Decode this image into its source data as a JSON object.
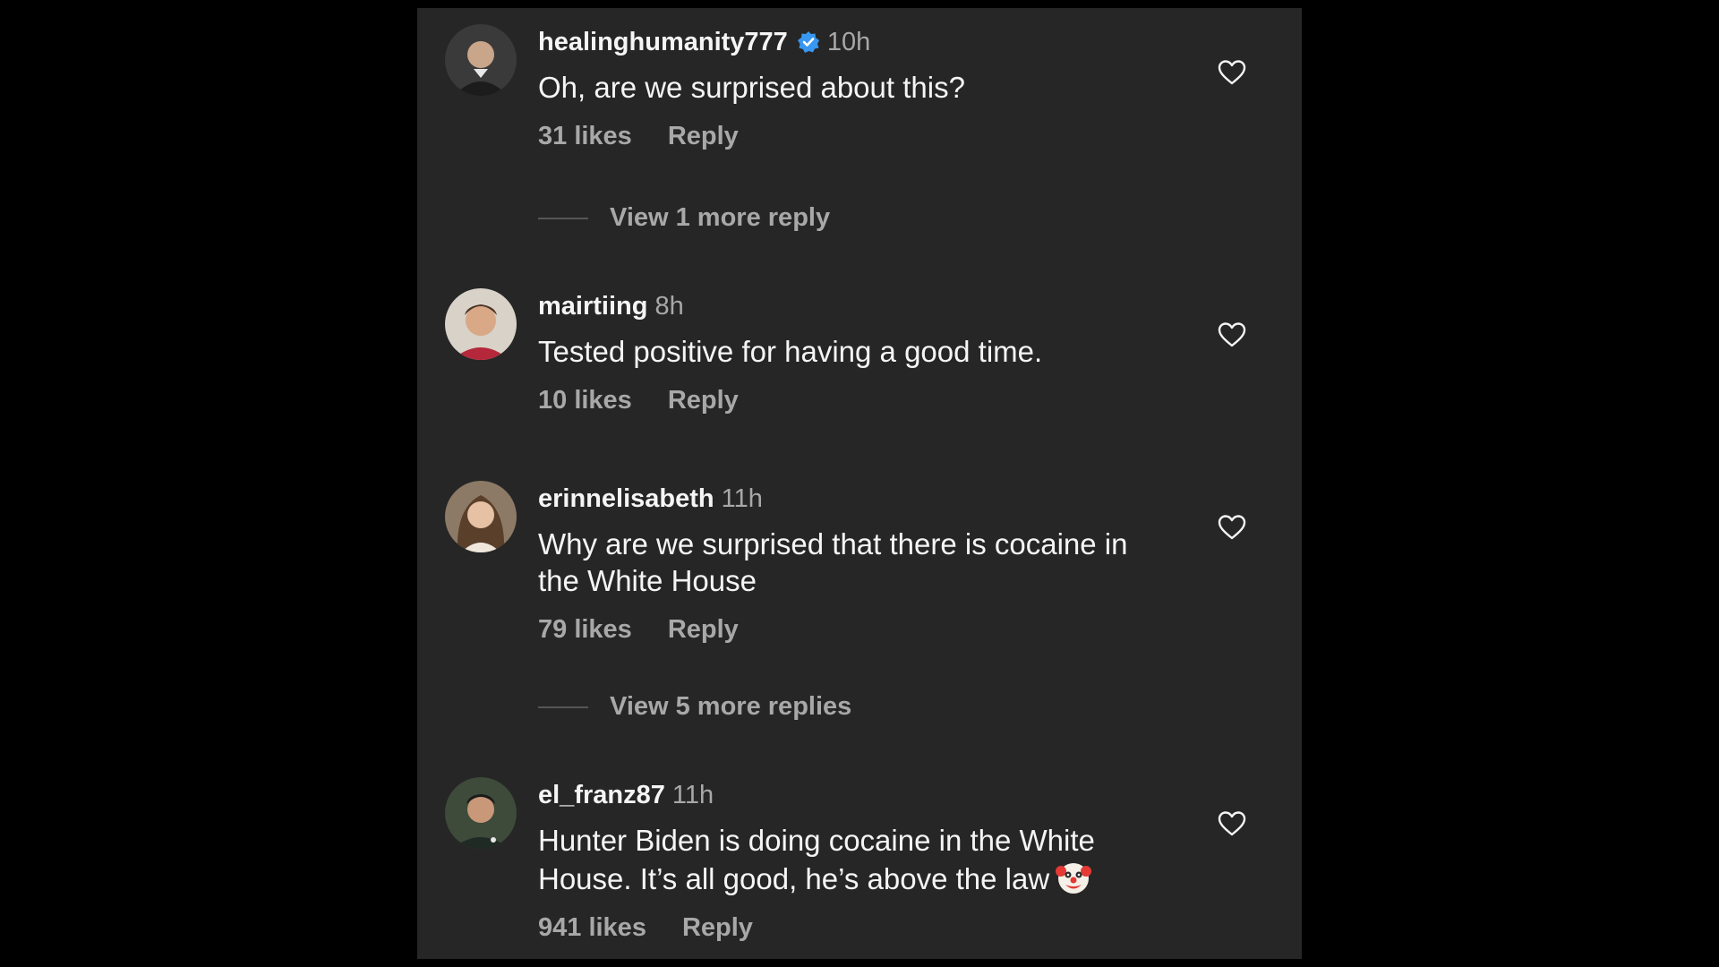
{
  "comments": [
    {
      "username": "healinghumanity777",
      "verified": true,
      "time": "10h",
      "text": "Oh, are we surprised about this?",
      "likes": "31 likes",
      "reply": "Reply",
      "view_replies": "View 1 more reply"
    },
    {
      "username": "mairtiing",
      "verified": false,
      "time": "8h",
      "text": "Tested positive for having a good time.",
      "likes": "10 likes",
      "reply": "Reply"
    },
    {
      "username": "erinnelisabeth",
      "verified": false,
      "time": "11h",
      "text": "Why are we surprised that there is cocaine in the White House",
      "likes": "79 likes",
      "reply": "Reply",
      "view_replies": "View 5 more replies"
    },
    {
      "username": "el_franz87",
      "verified": false,
      "time": "11h",
      "text": "Hunter Biden is doing cocaine in the White House. It’s all good, he’s above the law",
      "emoji": "clown-face",
      "likes": "941 likes",
      "reply": "Reply"
    }
  ],
  "colors": {
    "background": "#000000",
    "panel": "#262626",
    "primary_text": "#f5f5f5",
    "secondary_text": "#a8a8a8",
    "verified_blue": "#3897f0"
  },
  "icons": {
    "like": "heart-outline-icon",
    "verified": "verified-badge-icon"
  }
}
